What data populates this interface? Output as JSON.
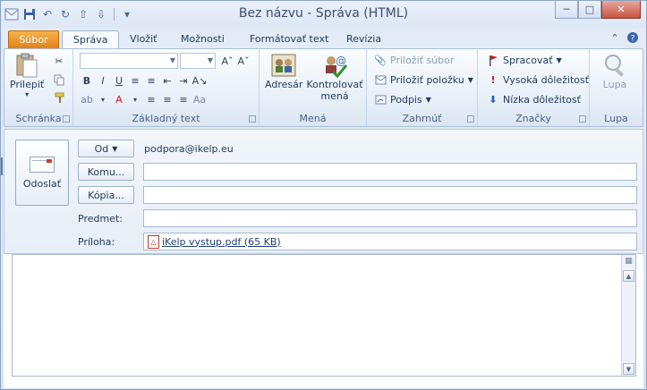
{
  "window": {
    "title": "Bez názvu  -  Správa (HTML)",
    "accent": "#e2801a",
    "close_color": "#c6533f"
  },
  "qat": {
    "icons": [
      "outlook-icon",
      "save-icon",
      "undo-icon",
      "redo-icon",
      "up-arrow-icon",
      "down-arrow-icon",
      "customize-icon"
    ]
  },
  "tabs": {
    "file": "Súbor",
    "items": [
      "Správa",
      "Vložiť",
      "Možnosti",
      "Formátovať text",
      "Revízia"
    ]
  },
  "ribbon": {
    "clipboard": {
      "paste": "Prilepiť",
      "label": "Schránka"
    },
    "basic_text": {
      "label": "Základný text"
    },
    "names": {
      "address_book": "Adresár",
      "check_names": "Kontrolovať mená",
      "label": "Mená"
    },
    "include": {
      "attach_file": "Priložiť súbor",
      "attach_item": "Priložiť položku",
      "signature": "Podpis",
      "label": "Zahrnúť"
    },
    "tags": {
      "follow_up": "Spracovať",
      "high": "Vysoká dôležitosť",
      "low": "Nízka dôležitosť",
      "label": "Značky"
    },
    "zoom": {
      "zoom": "Lupa",
      "label": "Lupa"
    }
  },
  "compose": {
    "send": "Odoslať",
    "from_btn": "Od",
    "from_value": "podpora@ikelp.eu",
    "to_btn": "Komu...",
    "cc_btn": "Kópia...",
    "subject_label": "Predmet:",
    "attachment_label": "Príloha:",
    "attachment": "iKelp vystup.pdf (65 KB)",
    "to_value": "",
    "cc_value": "",
    "subject_value": ""
  }
}
